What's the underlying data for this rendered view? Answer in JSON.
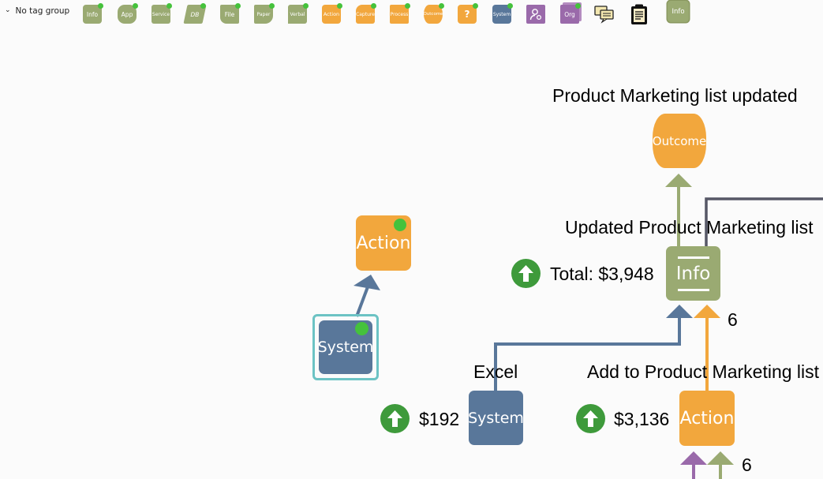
{
  "toolbar": {
    "tag_group_label": "No tag group",
    "palette": [
      {
        "label": "Info",
        "color": "#9aaa72"
      },
      {
        "label": "App",
        "color": "#9aaa72"
      },
      {
        "label": "Service",
        "color": "#9aaa72"
      },
      {
        "label": "DB",
        "color": "#9aaa72"
      },
      {
        "label": "File",
        "color": "#9aaa72"
      },
      {
        "label": "Paper",
        "color": "#9aaa72"
      },
      {
        "label": "Verbal",
        "color": "#9aaa72"
      },
      {
        "label": "Action",
        "color": "#f2a73d"
      },
      {
        "label": "Capture",
        "color": "#f2a73d"
      },
      {
        "label": "Process",
        "color": "#f2a73d"
      },
      {
        "label": "Outcome",
        "color": "#f2a73d"
      },
      {
        "label": "?",
        "color": "#f2a73d"
      },
      {
        "label": "System",
        "color": "#59779a"
      },
      {
        "label": "",
        "icon": "person-gear-icon",
        "color": "#9a6aaa"
      },
      {
        "label": "Org",
        "color": "#9a6aaa"
      },
      {
        "label": "",
        "icon": "comments-icon"
      },
      {
        "label": "",
        "icon": "clipboard-icon"
      },
      {
        "label": "Info",
        "color": "#9aaa72"
      }
    ]
  },
  "diagram": {
    "outcome_title": "Product Marketing list updated",
    "outcome_node": "Outcome",
    "info_title": "Updated Product Marketing list",
    "info_node": "Info",
    "info_total": "Total: $3,948",
    "info_count": "6",
    "action_node_standalone": "Action",
    "system_node_selected": "System",
    "excel_title": "Excel",
    "excel_node": "System",
    "excel_cost": "$192",
    "add_title": "Add to Product Marketing list",
    "add_node": "Action",
    "add_cost": "$3,136",
    "add_count": "6"
  },
  "colors": {
    "info": "#9aaa72",
    "action": "#f2a73d",
    "system": "#59779a",
    "purple": "#9a6aaa",
    "badge": "#3e9a3b",
    "selected_outline": "#6cc3c4",
    "status_dot": "#45c23c"
  }
}
